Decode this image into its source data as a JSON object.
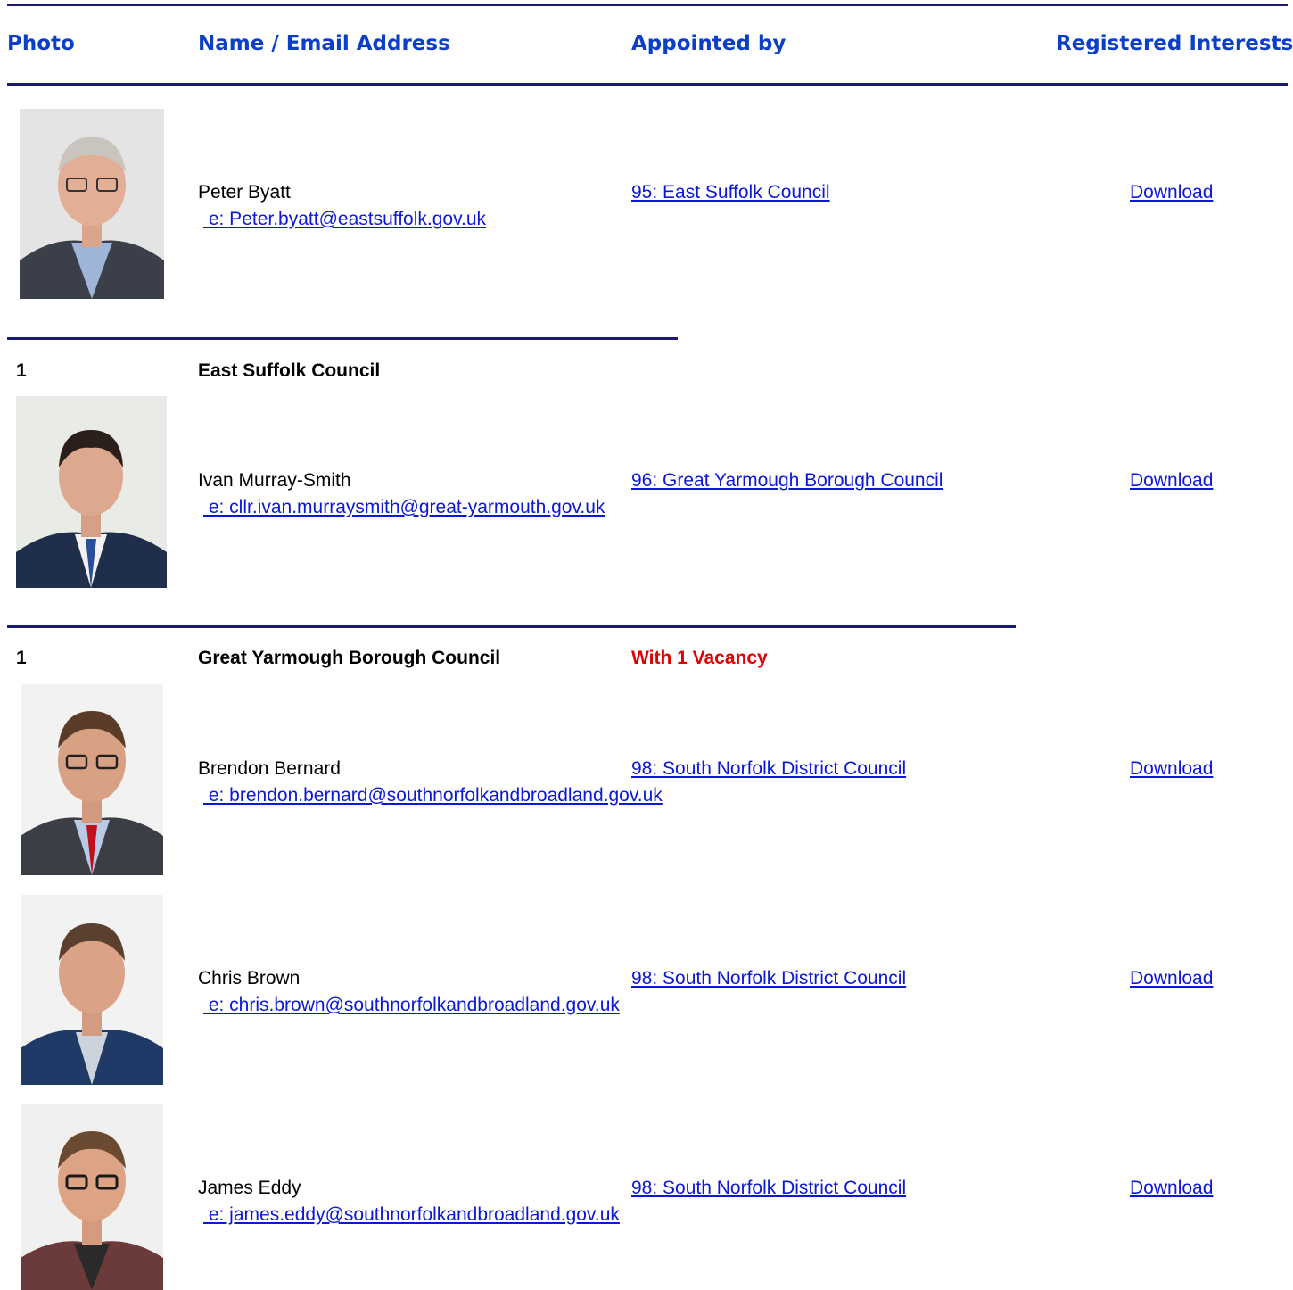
{
  "header": {
    "photo": "Photo",
    "name_email": "Name / Email Address",
    "appointed_by": "Appointed by",
    "registered_interests": "Registered Interests"
  },
  "members": [
    {
      "name": "Peter Byatt",
      "email": " e: Peter.byatt@eastsuffolk.gov.uk",
      "appointed_by": "95: East Suffolk Council",
      "interests": "Download"
    },
    {
      "name": "Ivan Murray-Smith",
      "email": " e: cllr.ivan.murraysmith@great-yarmouth.gov.uk",
      "appointed_by": "96: Great Yarmough Borough Council",
      "interests": "Download"
    },
    {
      "name": "Brendon Bernard",
      "email": " e: brendon.bernard@southnorfolkandbroadland.gov.uk",
      "appointed_by": "98: South Norfolk District Council",
      "interests": "Download"
    },
    {
      "name": "Chris Brown",
      "email": " e: chris.brown@southnorfolkandbroadland.gov.uk",
      "appointed_by": "98: South Norfolk District Council",
      "interests": "Download"
    },
    {
      "name": "James Eddy",
      "email": " e: james.eddy@southnorfolkandbroadland.gov.uk",
      "appointed_by": "98: South Norfolk District Council",
      "interests": "Download"
    }
  ],
  "groups": [
    {
      "count": "1",
      "name": "East Suffolk Council",
      "vacancy": ""
    },
    {
      "count": "1",
      "name": "Great Yarmough Borough Council",
      "vacancy": "With 1 Vacancy"
    }
  ],
  "colors": {
    "header_text": "#0b3fc7",
    "rule": "#1a1a6e",
    "link": "#0b18d8",
    "vacancy": "#e00000"
  }
}
